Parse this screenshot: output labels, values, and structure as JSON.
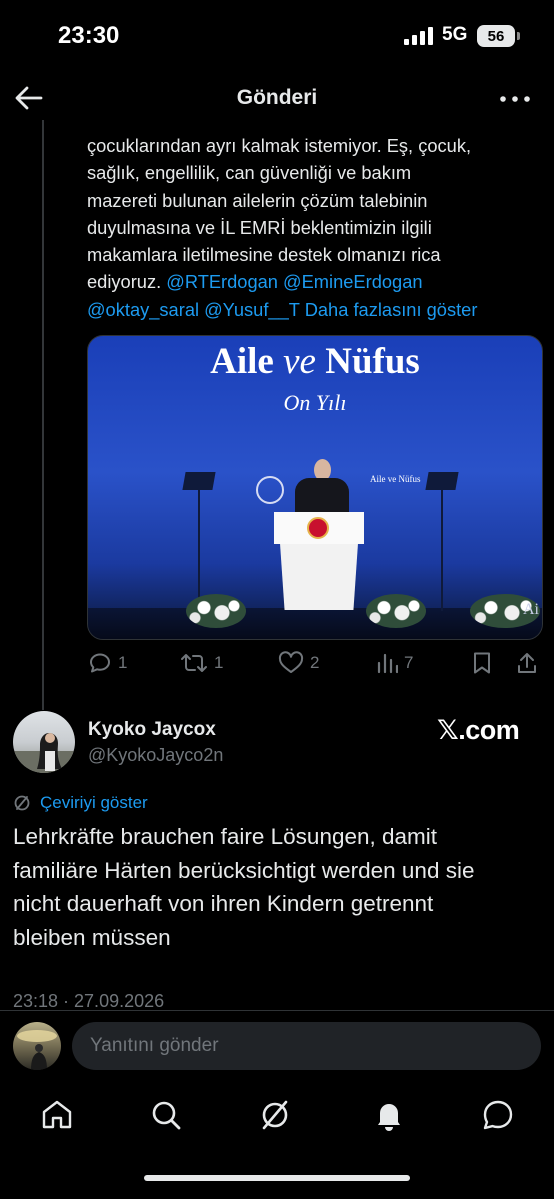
{
  "status_bar": {
    "time": "23:30",
    "network": "5G",
    "battery": "56"
  },
  "header": {
    "title": "Gönderi",
    "back_icon": "arrow-left-icon",
    "more_icon": "more-horizontal-icon"
  },
  "quoted_tweet": {
    "text": "çocuklarından ayrı kalmak istemiyor. Eş, çocuk,\nsağlık, engellilik, can güvenliği ve bakım\nmazereti bulunan ailelerin çözüm talebinin\nduyulmasına ve İL EMRİ beklentimizin ilgili\nmakamlara iletilmesine destek olmanızı rica\nediyoruz. ",
    "mentions_line1": "@RTErdogan @EmineErdogan",
    "mentions_line2": "@oktay_saral @Yusuf__T",
    "show_more": "Daha fazlasını göster",
    "media": {
      "title_a": "Aile ",
      "title_ve": "ve",
      "title_b": " Nüfus",
      "subtitle": "On Yılı",
      "small_title": "Aile ve Nüfus",
      "corner": "Ai"
    },
    "actions": {
      "replies": "1",
      "reposts": "1",
      "likes": "2",
      "views": "7"
    }
  },
  "tweet": {
    "display_name": "Kyoko Jaycox",
    "handle": "@KyokoJayco2n",
    "watermark": "𝕏.com",
    "translate_label": "Çeviriyi göster",
    "text": "Lehrkräfte brauchen faire Lösungen, damit\nfamiliäre Härten berücksichtigt werden und sie\nnicht dauerhaft von ihren Kindern getrennt\nbleiben müssen",
    "timestamp": "23:18 · 27.09.2026"
  },
  "reply": {
    "placeholder": "Yanıtını gönder"
  },
  "bottom_nav": [
    "home-icon",
    "search-icon",
    "grok-icon",
    "notifications-icon",
    "messages-icon"
  ],
  "colors": {
    "background": "#000000",
    "link": "#1d9bf0",
    "muted": "#71767b",
    "text": "#e7e9ea"
  }
}
